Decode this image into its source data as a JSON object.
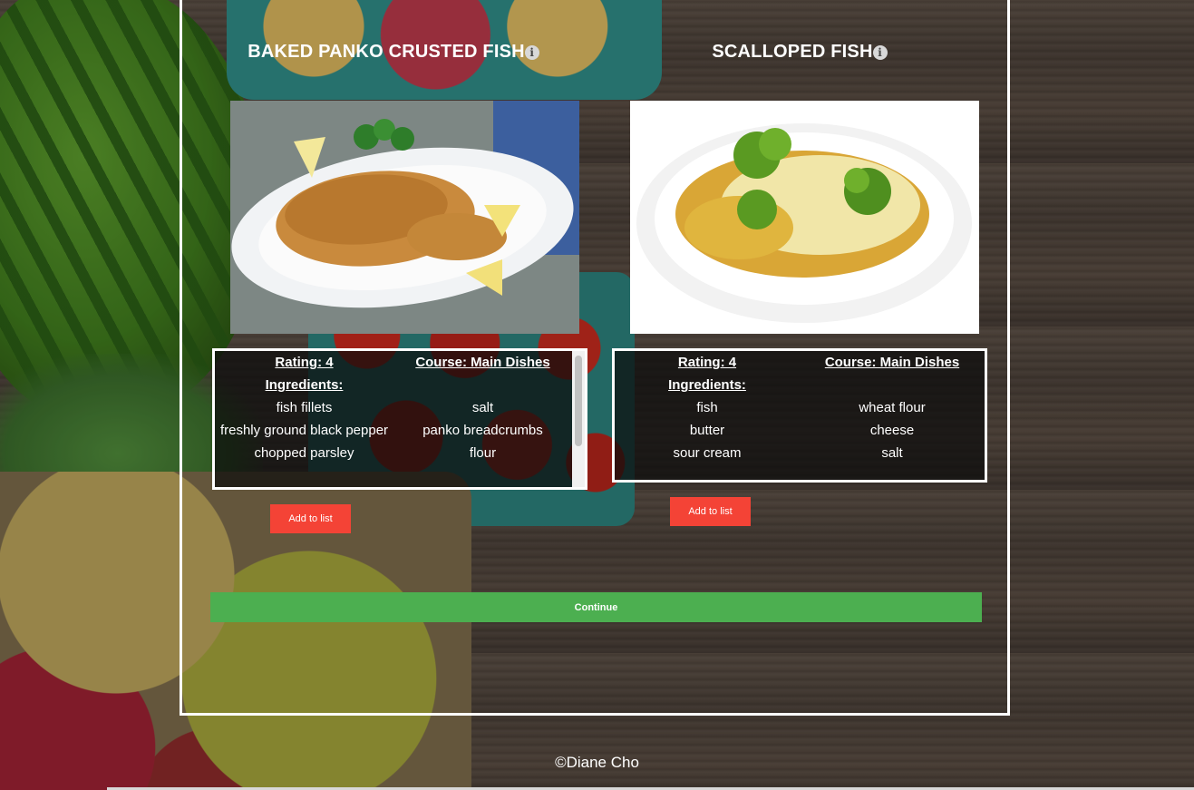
{
  "recipes": [
    {
      "title": "BAKED PANKO CRUSTED FISH",
      "info_icon": "info-circle-icon",
      "rating_label": "Rating: 4",
      "course_label": "Course: Main Dishes",
      "ingredients_label": "Ingredients:",
      "ingredients": [
        "fish fillets",
        "salt",
        "freshly ground black pepper",
        "panko breadcrumbs",
        "chopped parsley",
        "flour"
      ],
      "add_button": "Add to list"
    },
    {
      "title": "SCALLOPED FISH",
      "info_icon": "info-circle-icon",
      "rating_label": "Rating: 4",
      "course_label": "Course: Main Dishes",
      "ingredients_label": "Ingredients:",
      "ingredients": [
        "fish",
        "wheat flour",
        "butter",
        "cheese",
        "sour cream",
        "salt"
      ],
      "add_button": "Add to list"
    }
  ],
  "continue_button": "Continue",
  "footer": "©Diane Cho",
  "colors": {
    "add_button": "#f44336",
    "continue_button": "#4caf50",
    "frame_border": "#ffffff"
  }
}
